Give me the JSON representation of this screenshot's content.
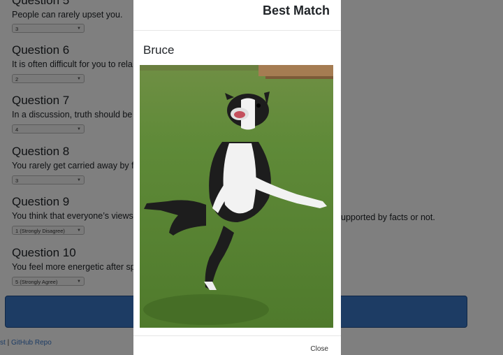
{
  "questions": [
    {
      "title": "Question 5",
      "text": "People can rarely upset you.",
      "value": "3"
    },
    {
      "title": "Question 6",
      "text": "It is often difficult for you to rela",
      "value": "2"
    },
    {
      "title": "Question 7",
      "text": "In a discussion, truth should be",
      "value": "4"
    },
    {
      "title": "Question 8",
      "text": "You rarely get carried away by f",
      "value": "3"
    },
    {
      "title": "Question 9",
      "text": "You think that everyone’s views",
      "text_tail": "upported by facts or not.",
      "value": "1 (Strongly Disagree)"
    },
    {
      "title": "Question 10",
      "text": "You feel more energetic after sp",
      "value": "5 (Strongly Agree)"
    }
  ],
  "footer": {
    "link_left": "st",
    "separator": "|",
    "github_label": "GitHub Repo"
  },
  "modal": {
    "title": "Best Match",
    "name": "Bruce",
    "close_label": "Close"
  },
  "colors": {
    "primary": "#3a78c9",
    "backdrop": "rgba(0,0,0,0.5)"
  }
}
